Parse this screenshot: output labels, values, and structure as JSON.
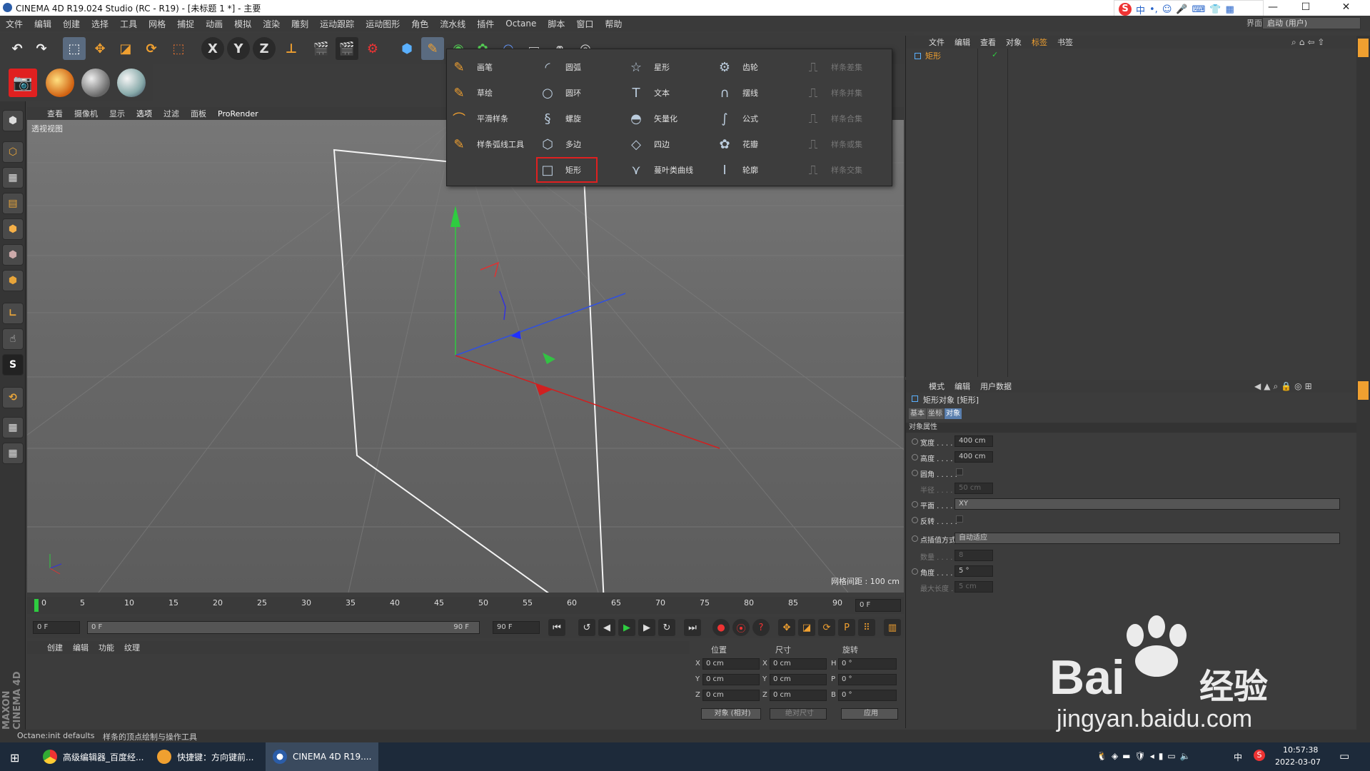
{
  "window": {
    "title": "CINEMA 4D R19.024 Studio (RC - R19) - [未标题 1 *] - 主要",
    "minimize": "—",
    "maximize": "☐",
    "close": "✕"
  },
  "menubar": {
    "items": [
      "文件",
      "编辑",
      "创建",
      "选择",
      "工具",
      "网格",
      "捕捉",
      "动画",
      "模拟",
      "渲染",
      "雕刻",
      "运动跟踪",
      "运动图形",
      "角色",
      "流水线",
      "插件",
      "Octane",
      "脚本",
      "窗口",
      "帮助"
    ],
    "layout_label": "界面:",
    "layout_value": "启动 (用户)"
  },
  "toolbar": {
    "axis_x": "X",
    "axis_y": "Y",
    "axis_z": "Z"
  },
  "viewport": {
    "menu": [
      "查看",
      "摄像机",
      "显示",
      "选项",
      "过滤",
      "面板",
      "ProRender"
    ],
    "active_menu": "选项",
    "label": "透视视图",
    "grid_info": "网格间距 : 100 cm"
  },
  "spline_menu": {
    "col1": [
      "画笔",
      "草绘",
      "平滑样条",
      "样条弧线工具"
    ],
    "col2": [
      "圆弧",
      "圆环",
      "螺旋",
      "多边",
      "矩形"
    ],
    "col3": [
      "星形",
      "文本",
      "矢量化",
      "四边",
      "蔓叶类曲线"
    ],
    "col4": [
      "齿轮",
      "摆线",
      "公式",
      "花瓣",
      "轮廓"
    ],
    "col5": [
      "样条差集",
      "样条并集",
      "样条合集",
      "样条或集",
      "样条交集"
    ],
    "selected": "矩形"
  },
  "timeline": {
    "ticks": [
      "0",
      "5",
      "10",
      "15",
      "20",
      "25",
      "30",
      "35",
      "40",
      "45",
      "50",
      "55",
      "60",
      "65",
      "70",
      "75",
      "80",
      "85",
      "90"
    ],
    "end_field": "0 F"
  },
  "transport": {
    "start": "0 F",
    "range_start": "0 F",
    "range_end": "90 F",
    "end": "90 F"
  },
  "material_panel": {
    "menu": [
      "创建",
      "编辑",
      "功能",
      "纹理"
    ]
  },
  "coords": {
    "headers": [
      "位置",
      "尺寸",
      "旋转"
    ],
    "rows": [
      {
        "a": "X",
        "pos": "0 cm",
        "b": "X",
        "size": "0 cm",
        "c": "H",
        "rot": "0 °"
      },
      {
        "a": "Y",
        "pos": "0 cm",
        "b": "Y",
        "size": "0 cm",
        "c": "P",
        "rot": "0 °"
      },
      {
        "a": "Z",
        "pos": "0 cm",
        "b": "Z",
        "size": "0 cm",
        "c": "B",
        "rot": "0 °"
      }
    ],
    "mode": "对象 (相对)",
    "size_mode": "绝对尺寸",
    "apply": "应用"
  },
  "status": {
    "left": "Octane:init defaults",
    "message": "样条的顶点绘制与操作工具"
  },
  "object_manager": {
    "menu": [
      "文件",
      "编辑",
      "查看",
      "对象",
      "标签",
      "书签"
    ],
    "object": "矩形"
  },
  "attributes": {
    "menu": [
      "模式",
      "编辑",
      "用户数据"
    ],
    "title": "矩形对象 [矩形]",
    "tabs": [
      "基本",
      "坐标",
      "对象"
    ],
    "active_tab": "对象",
    "section": "对象属性",
    "fields": [
      {
        "label": "宽度 . . . . .",
        "value": "400 cm",
        "enabled": true
      },
      {
        "label": "高度 . . . . .",
        "value": "400 cm",
        "enabled": true
      },
      {
        "label": "圆角 . . . . .",
        "value": "",
        "enabled": true
      },
      {
        "label": "半径 . . . . .",
        "value": "50 cm",
        "enabled": false
      },
      {
        "label": "平面 . . . . .",
        "value": "XY",
        "enabled": true
      },
      {
        "label": "反转 . . . . .",
        "value": "",
        "enabled": true
      },
      {
        "label": "点插值方式",
        "value": "自动适应",
        "enabled": true
      },
      {
        "label": "数量 . . . . .",
        "value": "8",
        "enabled": false
      },
      {
        "label": "角度 . . . . .",
        "value": "5 °",
        "enabled": true
      },
      {
        "label": "最大长度 . .",
        "value": "5 cm",
        "enabled": false
      }
    ]
  },
  "taskbar": {
    "tasks": [
      "高级编辑器_百度经...",
      "快捷键：方向键前...",
      "CINEMA 4D R19...."
    ],
    "time": "10:57:38",
    "date": "2022-03-07",
    "ime": "中"
  },
  "watermark": {
    "brand": "Bai",
    "brand2": "经验",
    "url": "jingyan.baidu.com"
  },
  "side_brand": "MAXON CINEMA 4D"
}
